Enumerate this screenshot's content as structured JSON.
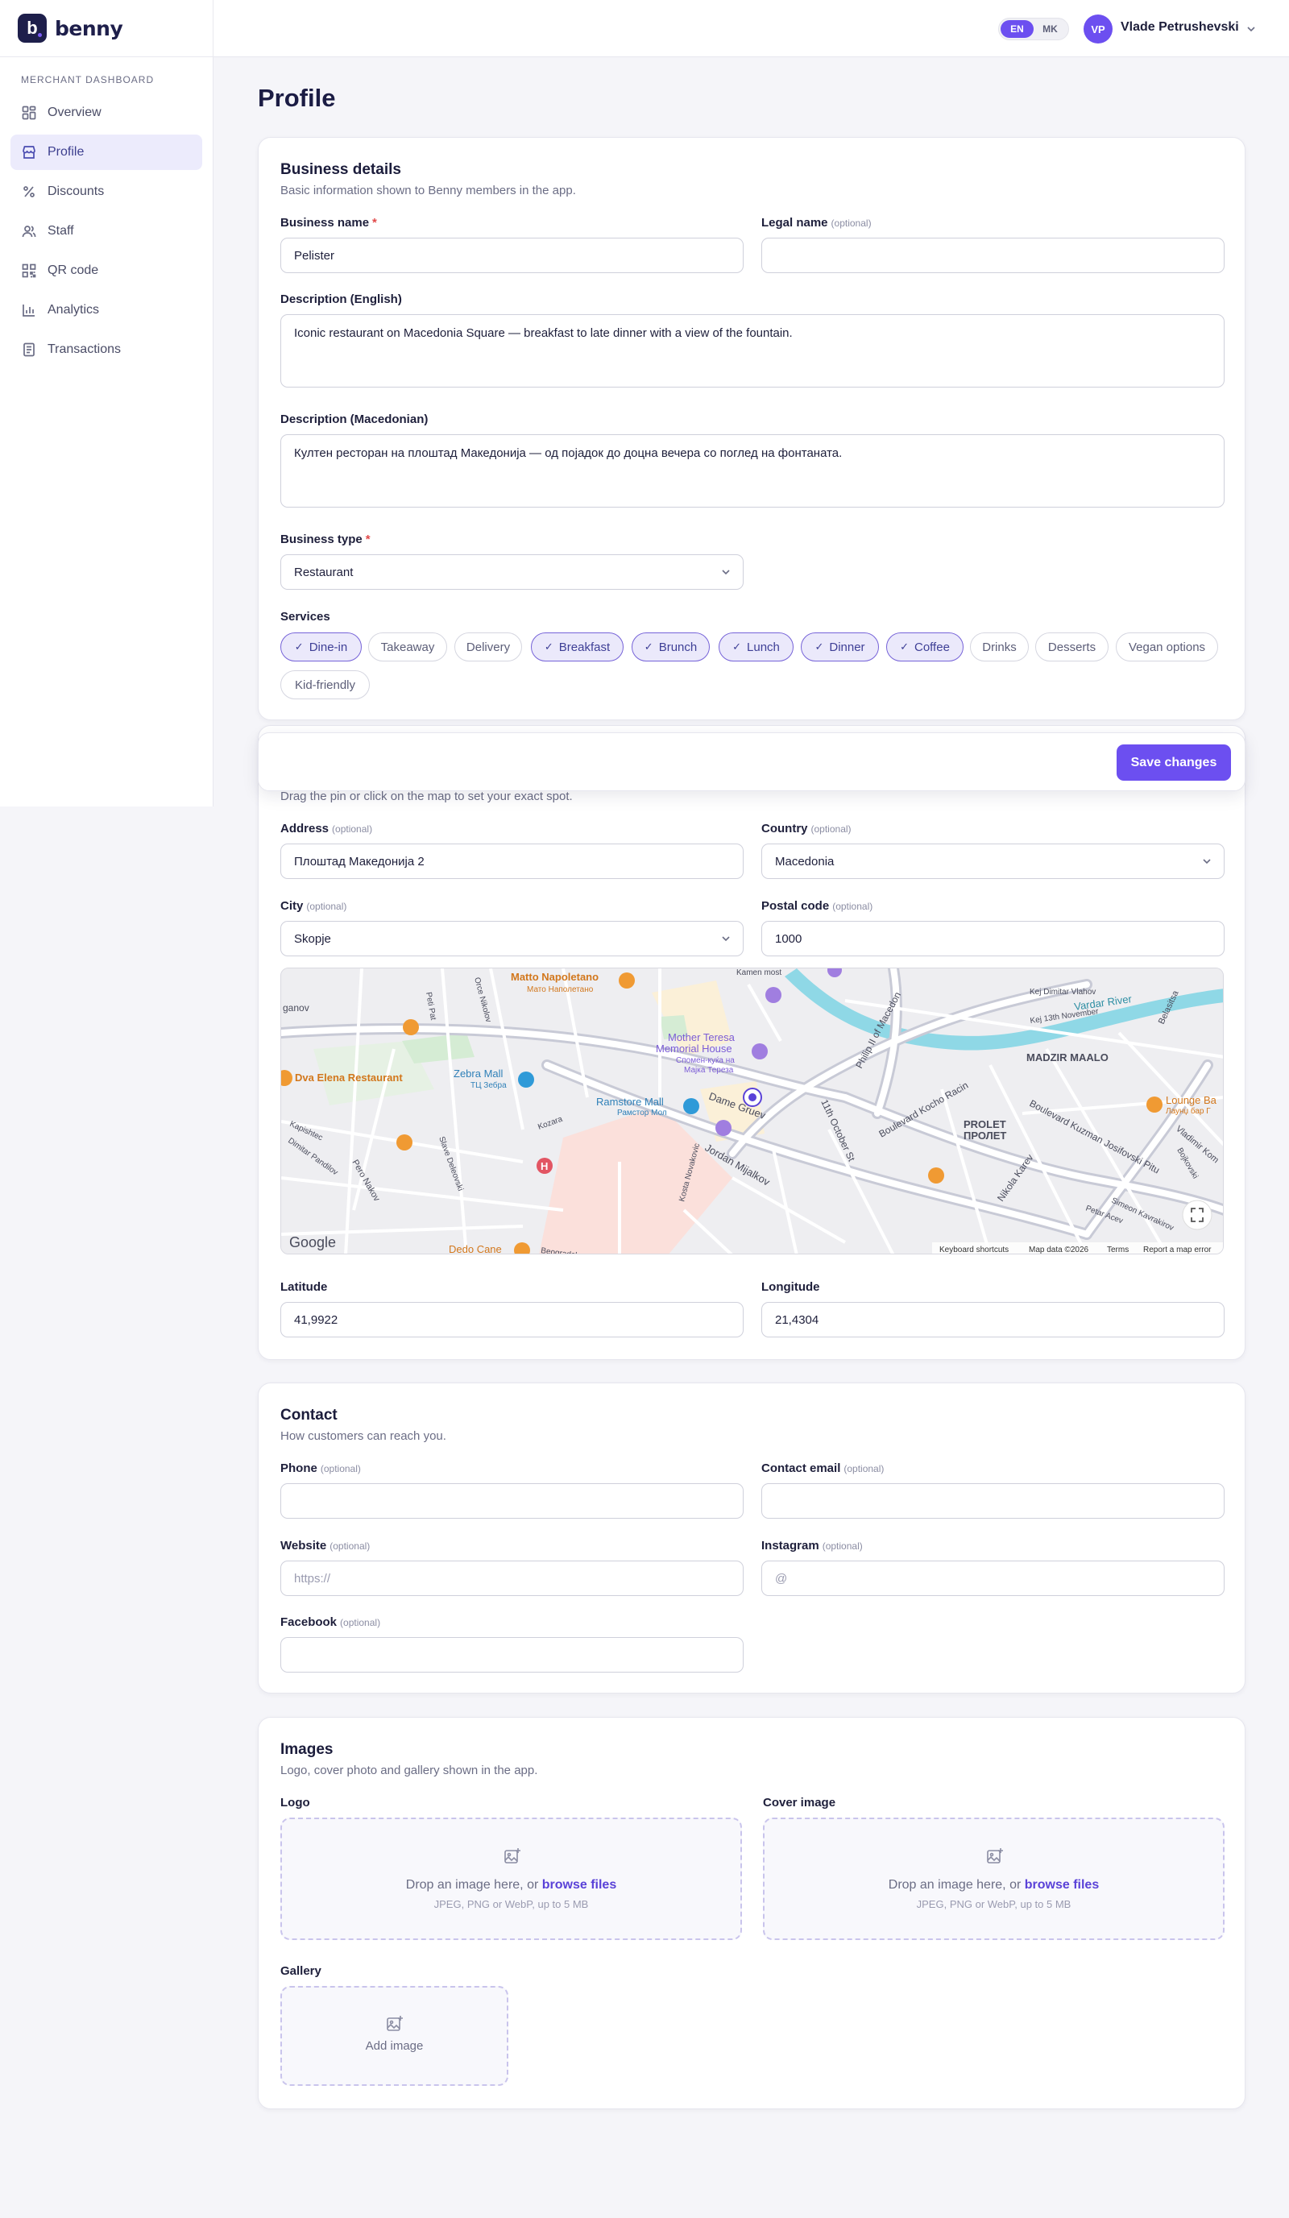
{
  "brand": {
    "name": "benny",
    "mark": "b"
  },
  "sidebar": {
    "section": "MERCHANT DASHBOARD",
    "items": [
      {
        "label": "Overview"
      },
      {
        "label": "Profile"
      },
      {
        "label": "Discounts"
      },
      {
        "label": "Staff"
      },
      {
        "label": "QR code"
      },
      {
        "label": "Analytics"
      },
      {
        "label": "Transactions"
      }
    ]
  },
  "topbar": {
    "lang_en": "EN",
    "lang_mk": "MK",
    "avatar": "VP",
    "user": "Vlade Petrushevski"
  },
  "page": {
    "title": "Profile"
  },
  "business": {
    "title": "Business details",
    "subtitle": "Basic information shown to Benny members in the app.",
    "name_label": "Business name",
    "name_value": "Pelister",
    "legal_label": "Legal name",
    "legal_value": "",
    "optional": "(optional)",
    "required": "*",
    "desc_en_label": "Description (English)",
    "desc_en_value": "Iconic restaurant on Macedonia Square — breakfast to late dinner with a view of the fountain.",
    "desc_mk_label": "Description (Macedonian)",
    "desc_mk_value": "Култен ресторан на плоштад Македонија — од појадок до доцна вечера со поглед на фонтаната.",
    "type_label": "Business type",
    "type_value": "Restaurant",
    "services_label": "Services",
    "services": [
      {
        "label": "Dine-in",
        "selected": true
      },
      {
        "label": "Takeaway",
        "selected": false
      },
      {
        "label": "Delivery",
        "selected": false
      },
      {
        "label": "Breakfast",
        "selected": true
      },
      {
        "label": "Brunch",
        "selected": true
      },
      {
        "label": "Lunch",
        "selected": true
      },
      {
        "label": "Dinner",
        "selected": true
      },
      {
        "label": "Coffee",
        "selected": true
      },
      {
        "label": "Drinks",
        "selected": false
      },
      {
        "label": "Desserts",
        "selected": false
      },
      {
        "label": "Vegan options",
        "selected": false
      },
      {
        "label": "Kid-friendly",
        "selected": false
      }
    ]
  },
  "savebar": {
    "button": "Save changes"
  },
  "location": {
    "hint": "Drag the pin or click on the map to set your exact spot.",
    "address_label": "Address",
    "address_value": "Плоштад Македонија 2",
    "country_label": "Country",
    "country_value": "Macedonia",
    "city_label": "City",
    "city_value": "Skopje",
    "postal_label": "Postal code",
    "postal_value": "1000",
    "lat_label": "Latitude",
    "lat_value": "41,9922",
    "lng_label": "Longitude",
    "lng_value": "21,4304",
    "map": {
      "labels": [
        "Matto Napoletano",
        "Мато Наполетано",
        "Mother Teresa",
        "Memorial House",
        "Спомен-куќа на",
        "Мајка Тереза",
        "Zebra Mall",
        "ТЦ Зебра",
        "Ramstore Mall",
        "Рамстор Мол",
        "Dva Elena Restaurant",
        "MADZIR MAALO",
        "PROLET",
        "ПРОЛЕТ",
        "Lounge Ba",
        "Лаунџ бар Г",
        "Dedo Cane",
        "Vardar River",
        "Dame Gruev",
        "Jordan Mijalkov",
        "Boulevard Kocho Racin",
        "Boulevard Kuzman Josifovski Pitu",
        "11th October St",
        "Philip II of Macedon",
        "Nikola Karev",
        "Kej Dimitar Vlahov",
        "Kej 13th November",
        "Belasitsa",
        "Kapishtec",
        "Dimitar Pandilov",
        "Pero Nakov",
        "Kozara",
        "Orce Nikolov",
        "Kamen most",
        "Vladimir Kom",
        "Petar Acev",
        "Simeon Kavrakirov",
        "Slave Deleovski",
        "Beogradska",
        "Bojkovski",
        "Kosta Novakovic",
        "Peti Pat",
        "ganov",
        "Google"
      ],
      "footer": [
        "Keyboard shortcuts",
        "Map data ©2026",
        "Terms",
        "Report a map error"
      ]
    }
  },
  "contact": {
    "title": "Contact",
    "subtitle": "How customers can reach you.",
    "phone_label": "Phone",
    "phone_value": "",
    "email_label": "Contact email",
    "email_value": "",
    "website_label": "Website",
    "website_placeholder": "https://",
    "instagram_label": "Instagram",
    "instagram_placeholder": "@",
    "facebook_label": "Facebook",
    "facebook_value": ""
  },
  "images": {
    "title": "Images",
    "subtitle": "Logo, cover photo and gallery shown in the app.",
    "logo_label": "Logo",
    "cover_label": "Cover image",
    "gallery_label": "Gallery",
    "drop_text": "Drop an image here, or ",
    "browse": "browse files",
    "drop_hint": "JPEG, PNG or WebP, up to 5 MB",
    "add_image": "Add image"
  }
}
